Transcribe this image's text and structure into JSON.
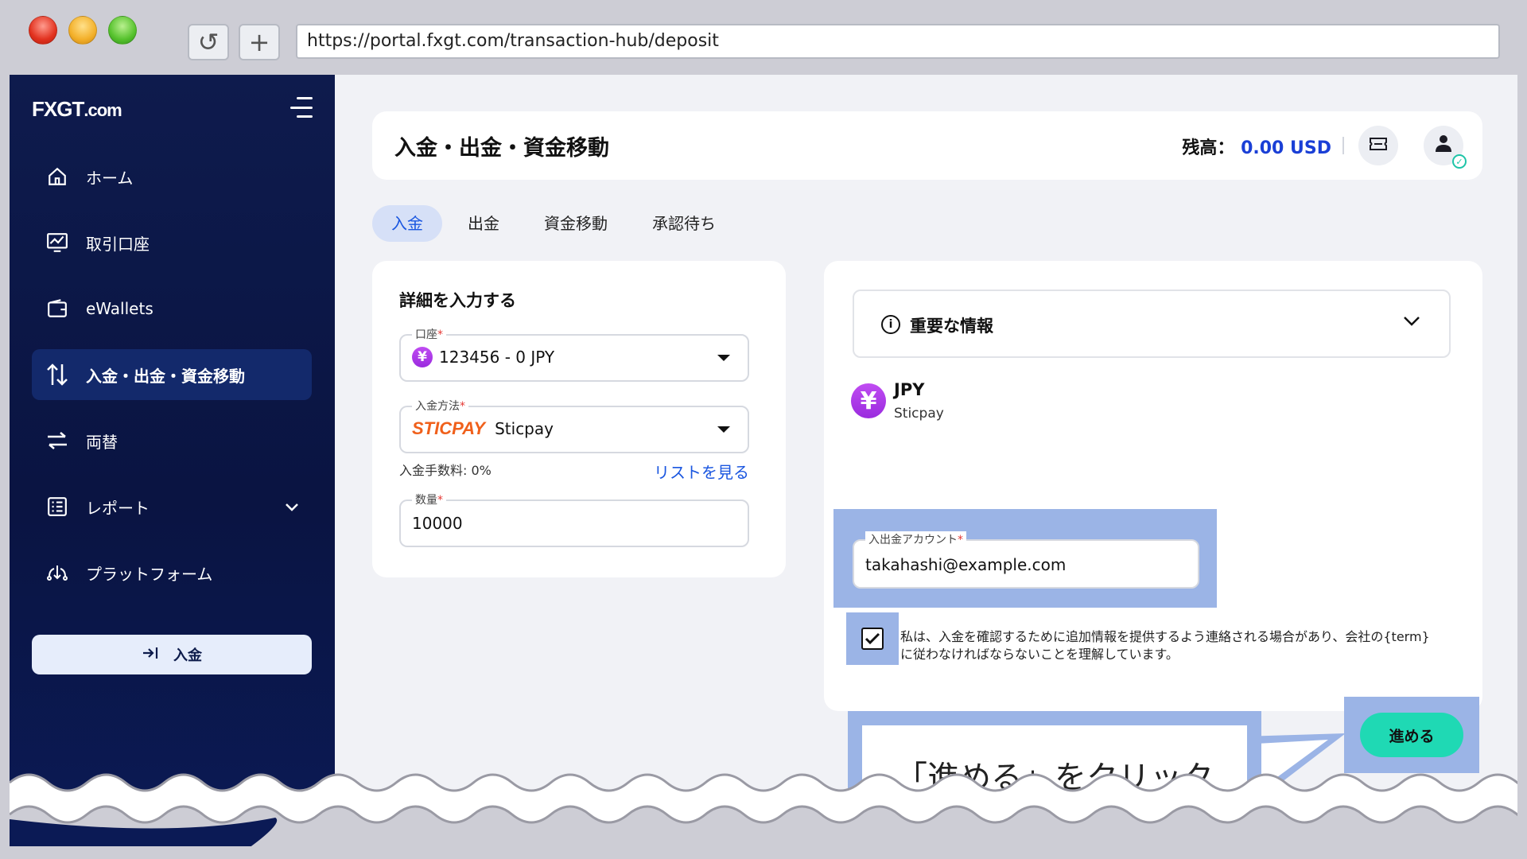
{
  "browser": {
    "url": "https://portal.fxgt.com/transaction-hub/deposit",
    "reload_icon": "reload-icon",
    "new_tab_icon": "plus-icon"
  },
  "sidebar": {
    "logo_main": "FXGT",
    "logo_suffix": ".com",
    "items": [
      {
        "label": "ホーム",
        "icon": "home-icon"
      },
      {
        "label": "取引口座",
        "icon": "chart-monitor-icon"
      },
      {
        "label": "eWallets",
        "icon": "wallet-icon"
      },
      {
        "label": "入金・出金・資金移動",
        "icon": "arrows-updown-icon",
        "active": true
      },
      {
        "label": "両替",
        "icon": "exchange-icon"
      },
      {
        "label": "レポート",
        "icon": "report-icon",
        "has_chevron": true
      },
      {
        "label": "プラットフォーム",
        "icon": "platform-icon"
      }
    ],
    "deposit_button": "入金"
  },
  "header": {
    "title": "入金・出金・資金移動",
    "balance_label": "残高：",
    "balance_value": "0.00 USD"
  },
  "tabs": [
    {
      "label": "入金",
      "active": true
    },
    {
      "label": "出金"
    },
    {
      "label": "資金移動"
    },
    {
      "label": "承認待ち"
    }
  ],
  "form": {
    "section_title": "詳細を入力する",
    "account_label": "口座",
    "account_value": "123456 - 0 JPY",
    "account_currency_symbol": "¥",
    "method_label": "入金方法",
    "method_logo": "STICPAY",
    "method_value": "Sticpay",
    "fee_text": "入金手数料: 0%",
    "list_link": "リストを見る",
    "amount_label": "数量",
    "amount_value": "10000",
    "required_mark": "*"
  },
  "details": {
    "important_label": "重要な情報",
    "currency_symbol": "¥",
    "currency": "JPY",
    "method": "Sticpay",
    "account_field_label": "入出金アカウント",
    "account_field_value": "takahashi@example.com",
    "consent_text": "私は、入金を確認するために追加情報を提供するよう連絡される場合があり、会社の{term}に従わなければならないことを理解しています。",
    "checkbox_checked": true,
    "proceed_button": "進める"
  },
  "annotation": {
    "callout_text": "「進める」をクリック",
    "highlight_color": "#9bb4e6"
  },
  "colors": {
    "sidebar_bg": "#0e1b4d",
    "accent_blue": "#1a56e0",
    "proceed_green": "#1fd9b4",
    "sticpay_orange": "#f0601b",
    "currency_purple": "#b03fea"
  }
}
